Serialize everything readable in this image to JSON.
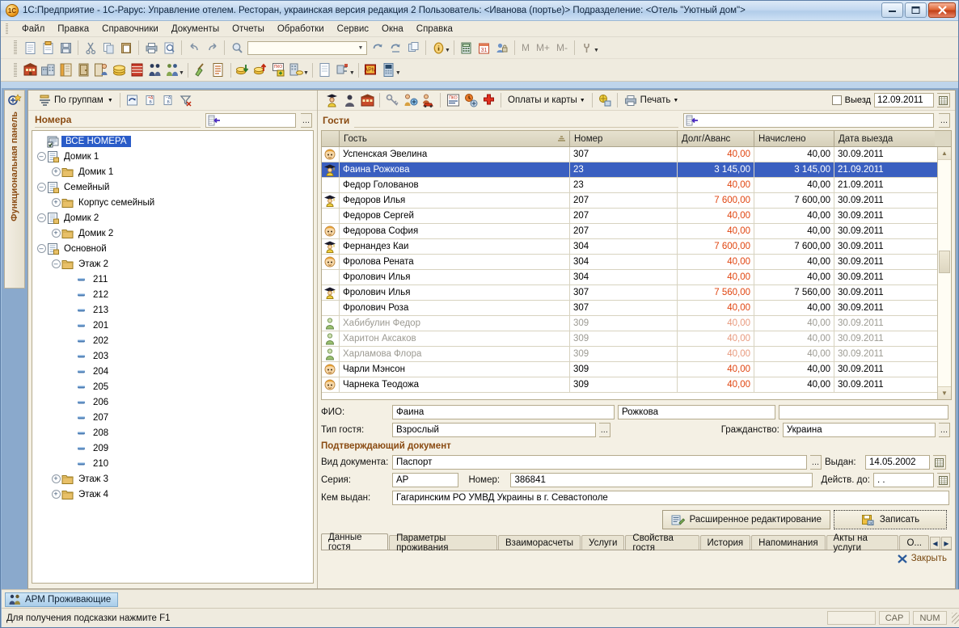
{
  "window": {
    "title": "1С:Предприятие - 1С-Рарус: Управление отелем. Ресторан, украинская версия редакция 2    Пользователь: <Иванова (портье)>    Подразделение: <Отель \"Уютный дом\">",
    "minimize": "—",
    "maximize": "❐",
    "close": "✕",
    "app_icon": "1c-logo-icon"
  },
  "menu": {
    "items": [
      "Файл",
      "Правка",
      "Справочники",
      "Документы",
      "Отчеты",
      "Обработки",
      "Сервис",
      "Окна",
      "Справка"
    ]
  },
  "toolbar_main": {
    "combo_value": "",
    "memory_buttons": [
      "M",
      "M+",
      "M-"
    ],
    "icons": [
      "new-document-icon",
      "open-document-icon",
      "save-icon",
      "cut-icon",
      "copy-icon",
      "paste-icon",
      "print-icon",
      "print-preview-icon",
      "undo-icon",
      "redo-icon",
      "find-icon",
      "refresh-icon",
      "refresh-all-icon",
      "copy-window-icon",
      "info-icon",
      "calculator-icon",
      "calendar-icon",
      "user-lock-icon",
      "settings-wrench-icon"
    ]
  },
  "toolbar_second": {
    "icons": [
      "hotel-icon",
      "hotels-icon",
      "book-orange-icon",
      "door-icon",
      "checkin-icon",
      "money-icon",
      "ledger-icon",
      "guests-icon",
      "group-guests-icon",
      "broom-icon",
      "list-icon",
      "cash-in-icon",
      "cash-out-icon",
      "pko-icon",
      "building-money-icon",
      "report-icon",
      "plug-icon",
      "arm-icon",
      "terminal-icon"
    ]
  },
  "function_panel": {
    "label": "Функциональная панель",
    "icon": "function-panel-icon"
  },
  "left_pane": {
    "group_button": "По группам",
    "toolbar_icons": [
      "refresh-icon",
      "add-item-icon",
      "edit-item-icon",
      "clear-filter-icon"
    ],
    "title": "Номера",
    "search_value": "",
    "dots_label": "...",
    "tree": [
      {
        "label": "ВСЕ НОМЕРА",
        "level": 0,
        "toggle": "none",
        "icon": "all-rooms-icon",
        "selected": true
      },
      {
        "label": "Домик 1",
        "level": 0,
        "toggle": "minus",
        "icon": "catalog-icon",
        "selected": false
      },
      {
        "label": "Домик 1",
        "level": 1,
        "toggle": "plus",
        "icon": "folder-icon",
        "selected": false
      },
      {
        "label": "Семейный",
        "level": 0,
        "toggle": "minus",
        "icon": "catalog-icon",
        "selected": false
      },
      {
        "label": "Корпус семейный",
        "level": 1,
        "toggle": "plus",
        "icon": "folder-icon",
        "selected": false
      },
      {
        "label": "Домик 2",
        "level": 0,
        "toggle": "minus",
        "icon": "catalog-icon",
        "selected": false
      },
      {
        "label": "Домик 2",
        "level": 1,
        "toggle": "plus",
        "icon": "folder-icon",
        "selected": false
      },
      {
        "label": "Основной",
        "level": 0,
        "toggle": "minus",
        "icon": "catalog-icon",
        "selected": false
      },
      {
        "label": "Этаж 2",
        "level": 1,
        "toggle": "minus",
        "icon": "folder-icon",
        "selected": false
      },
      {
        "label": "211",
        "level": 2,
        "toggle": "none",
        "icon": "room-icon",
        "selected": false
      },
      {
        "label": "212",
        "level": 2,
        "toggle": "none",
        "icon": "room-icon",
        "selected": false
      },
      {
        "label": "213",
        "level": 2,
        "toggle": "none",
        "icon": "room-icon",
        "selected": false
      },
      {
        "label": "201",
        "level": 2,
        "toggle": "none",
        "icon": "room-icon",
        "selected": false
      },
      {
        "label": "202",
        "level": 2,
        "toggle": "none",
        "icon": "room-icon",
        "selected": false
      },
      {
        "label": "203",
        "level": 2,
        "toggle": "none",
        "icon": "room-icon",
        "selected": false
      },
      {
        "label": "204",
        "level": 2,
        "toggle": "none",
        "icon": "room-icon",
        "selected": false
      },
      {
        "label": "205",
        "level": 2,
        "toggle": "none",
        "icon": "room-icon",
        "selected": false
      },
      {
        "label": "206",
        "level": 2,
        "toggle": "none",
        "icon": "room-icon",
        "selected": false
      },
      {
        "label": "207",
        "level": 2,
        "toggle": "none",
        "icon": "room-icon",
        "selected": false
      },
      {
        "label": "208",
        "level": 2,
        "toggle": "none",
        "icon": "room-icon",
        "selected": false
      },
      {
        "label": "209",
        "level": 2,
        "toggle": "none",
        "icon": "room-icon",
        "selected": false
      },
      {
        "label": "210",
        "level": 2,
        "toggle": "none",
        "icon": "room-icon",
        "selected": false
      },
      {
        "label": "Этаж 3",
        "level": 1,
        "toggle": "plus",
        "icon": "folder-icon",
        "selected": false
      },
      {
        "label": "Этаж 4",
        "level": 1,
        "toggle": "plus",
        "icon": "folder-icon",
        "selected": false
      }
    ]
  },
  "right_pane": {
    "toolbar": {
      "payments_button": "Оплаты и карты",
      "print_button": "Печать",
      "checkout_checkbox_label": "Выезд",
      "checkout_date": "12.09.2011",
      "icons": [
        "guest-icon",
        "guest-dark-icon",
        "rooms-icon",
        "keys-icon",
        "move-guest-icon",
        "guest-car-icon",
        "pko-doc-icon",
        "clock-settings-icon",
        "red-cross-icon",
        "card-icon",
        "printer-icon",
        "calendar-picker-icon"
      ]
    },
    "title": "Гости",
    "search_value": "",
    "dots_label": "...",
    "table": {
      "columns": [
        "Гость",
        "Номер",
        "Долг/Аванс",
        "Начислено",
        "Дата выезда"
      ],
      "rows": [
        {
          "icon": "guest-child-icon",
          "guest": "Успенская Эвелина",
          "room": "307",
          "debt": "40,00",
          "accrued": "40,00",
          "date": "30.09.2011",
          "selected": false,
          "dim": false
        },
        {
          "icon": "guest-student-icon",
          "guest": "Фаина Рожкова",
          "room": "23",
          "debt": "3 145,00",
          "accrued": "3 145,00",
          "date": "21.09.2011",
          "selected": true,
          "dim": false
        },
        {
          "icon": "",
          "guest": "Федор Голованов",
          "room": "23",
          "debt": "40,00",
          "accrued": "40,00",
          "date": "21.09.2011",
          "selected": false,
          "dim": false
        },
        {
          "icon": "guest-student-icon",
          "guest": "Федоров Илья",
          "room": "207",
          "debt": "7 600,00",
          "accrued": "7 600,00",
          "date": "30.09.2011",
          "selected": false,
          "dim": false
        },
        {
          "icon": "",
          "guest": "Федоров Сергей",
          "room": "207",
          "debt": "40,00",
          "accrued": "40,00",
          "date": "30.09.2011",
          "selected": false,
          "dim": false
        },
        {
          "icon": "guest-child-icon",
          "guest": "Федорова София",
          "room": "207",
          "debt": "40,00",
          "accrued": "40,00",
          "date": "30.09.2011",
          "selected": false,
          "dim": false
        },
        {
          "icon": "guest-student-icon",
          "guest": "Фернандез Каи",
          "room": "304",
          "debt": "7 600,00",
          "accrued": "7 600,00",
          "date": "30.09.2011",
          "selected": false,
          "dim": false
        },
        {
          "icon": "guest-child-icon",
          "guest": "Фролова Рената",
          "room": "304",
          "debt": "40,00",
          "accrued": "40,00",
          "date": "30.09.2011",
          "selected": false,
          "dim": false
        },
        {
          "icon": "",
          "guest": "Фролович Илья",
          "room": "304",
          "debt": "40,00",
          "accrued": "40,00",
          "date": "30.09.2011",
          "selected": false,
          "dim": false
        },
        {
          "icon": "guest-student-icon",
          "guest": "Фролович Илья",
          "room": "307",
          "debt": "7 560,00",
          "accrued": "7 560,00",
          "date": "30.09.2011",
          "selected": false,
          "dim": false
        },
        {
          "icon": "",
          "guest": "Фролович Роза",
          "room": "307",
          "debt": "40,00",
          "accrued": "40,00",
          "date": "30.09.2011",
          "selected": false,
          "dim": false
        },
        {
          "icon": "guest-green-icon",
          "guest": "Хабибулин Федор",
          "room": "309",
          "debt": "40,00",
          "accrued": "40,00",
          "date": "30.09.2011",
          "selected": false,
          "dim": true
        },
        {
          "icon": "guest-green-icon",
          "guest": "Харитон Аксаков",
          "room": "309",
          "debt": "40,00",
          "accrued": "40,00",
          "date": "30.09.2011",
          "selected": false,
          "dim": true
        },
        {
          "icon": "guest-green-icon",
          "guest": "Харламова Флора",
          "room": "309",
          "debt": "40,00",
          "accrued": "40,00",
          "date": "30.09.2011",
          "selected": false,
          "dim": true
        },
        {
          "icon": "guest-child-icon",
          "guest": "Чарли Мэнсон",
          "room": "309",
          "debt": "40,00",
          "accrued": "40,00",
          "date": "30.09.2011",
          "selected": false,
          "dim": false
        },
        {
          "icon": "guest-child-icon",
          "guest": "Чарнека Теодожа",
          "room": "309",
          "debt": "40,00",
          "accrued": "40,00",
          "date": "30.09.2011",
          "selected": false,
          "dim": false
        }
      ]
    },
    "form": {
      "fio_label": "ФИО:",
      "fio_first": "Фаина",
      "fio_last": "Рожкова",
      "fio_middle": "",
      "guest_type_label": "Тип гостя:",
      "guest_type": "Взрослый",
      "citizenship_label": "Гражданство:",
      "citizenship": "Украина",
      "document_section": "Подтверждающий документ",
      "doc_type_label": "Вид документа:",
      "doc_type": "Паспорт",
      "issued_label": "Выдан:",
      "issued_date": "14.05.2002",
      "series_label": "Серия:",
      "series": "АР",
      "number_label": "Номер:",
      "number": "386841",
      "valid_until_label": "Действ. до:",
      "valid_until": ". .",
      "issued_by_label": "Кем выдан:",
      "issued_by": "Гагаринским РО УМВД Украины в г. Севастополе",
      "advanced_edit_button": "Расширенное редактирование",
      "save_button": "Записать"
    },
    "tabs": [
      {
        "label": "Данные гостя",
        "active": true
      },
      {
        "label": "Параметры проживания",
        "active": false
      },
      {
        "label": "Взаиморасчеты",
        "active": false
      },
      {
        "label": "Услуги",
        "active": false
      },
      {
        "label": "Свойства гостя",
        "active": false
      },
      {
        "label": "История",
        "active": false
      },
      {
        "label": "Напоминания",
        "active": false
      },
      {
        "label": "Акты на услуги",
        "active": false
      },
      {
        "label": "О...",
        "active": false
      }
    ],
    "close_label": "Закрыть"
  },
  "taskbar": {
    "button_label": "АРМ Проживающие",
    "button_icon": "arm-guests-icon"
  },
  "statusbar": {
    "hint": "Для получения подсказки нажмите F1",
    "cap": "CAP",
    "num": "NUM"
  },
  "colors": {
    "accent_brown": "#8a4b12",
    "selection_blue": "#3a5fc0",
    "debt_red": "#e04510",
    "panel_bg": "#f2eee2"
  }
}
